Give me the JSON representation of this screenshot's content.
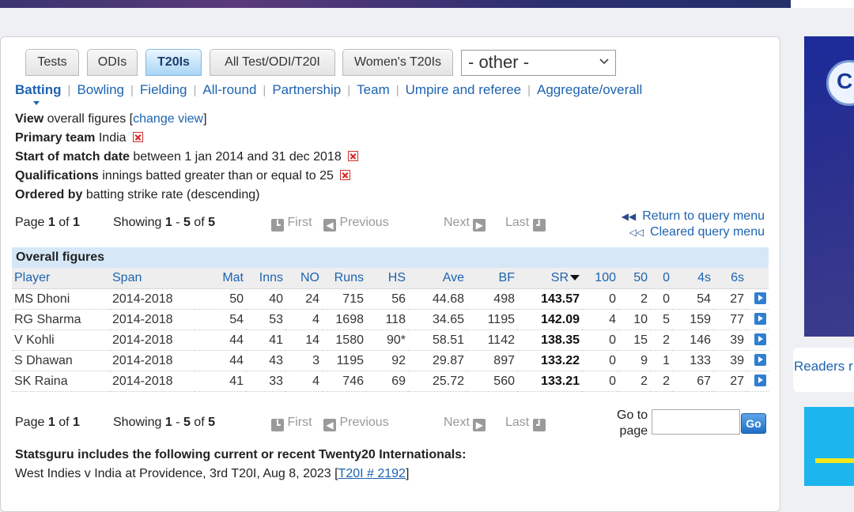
{
  "tabs": [
    {
      "label": "Tests",
      "active": false
    },
    {
      "label": "ODIs",
      "active": false
    },
    {
      "label": "T20Is",
      "active": true
    },
    {
      "label": "All Test/ODI/T20I",
      "active": false
    },
    {
      "label": "Women's T20Is",
      "active": false
    }
  ],
  "other_select": {
    "value": "- other -"
  },
  "subnav": [
    "Batting",
    "Bowling",
    "Fielding",
    "All-round",
    "Partnership",
    "Team",
    "Umpire and referee",
    "Aggregate/overall"
  ],
  "criteria": {
    "view": {
      "label": "View",
      "text": "overall figures [",
      "link": "change view",
      "close": "]"
    },
    "primary": {
      "label": "Primary team",
      "value": "India"
    },
    "date": {
      "label": "Start of match date",
      "value": "between 1 jan 2014 and 31 dec 2018"
    },
    "qual": {
      "label": "Qualifications",
      "value": "innings batted greater than or equal to 25"
    },
    "order": {
      "label": "Ordered by",
      "value": "batting strike rate (descending)"
    }
  },
  "pager": {
    "page_word": "Page",
    "page": "1",
    "of_word": "of",
    "pages": "1",
    "showing_word": "Showing",
    "from": "1",
    "to": "5",
    "total": "5",
    "first": "First",
    "previous": "Previous",
    "next": "Next",
    "last": "Last"
  },
  "query_links": {
    "return": "Return to query menu",
    "cleared": "Cleared query menu"
  },
  "table": {
    "caption": "Overall figures",
    "headers": [
      "Player",
      "Span",
      "Mat",
      "Inns",
      "NO",
      "Runs",
      "HS",
      "Ave",
      "BF",
      "SR",
      "100",
      "50",
      "0",
      "4s",
      "6s"
    ],
    "rows": [
      [
        "MS Dhoni",
        "2014-2018",
        "50",
        "40",
        "24",
        "715",
        "56",
        "44.68",
        "498",
        "143.57",
        "0",
        "2",
        "0",
        "54",
        "27"
      ],
      [
        "RG Sharma",
        "2014-2018",
        "54",
        "53",
        "4",
        "1698",
        "118",
        "34.65",
        "1195",
        "142.09",
        "4",
        "10",
        "5",
        "159",
        "77"
      ],
      [
        "V Kohli",
        "2014-2018",
        "44",
        "41",
        "14",
        "1580",
        "90*",
        "58.51",
        "1142",
        "138.35",
        "0",
        "15",
        "2",
        "146",
        "39"
      ],
      [
        "S Dhawan",
        "2014-2018",
        "44",
        "43",
        "3",
        "1195",
        "92",
        "29.87",
        "897",
        "133.22",
        "0",
        "9",
        "1",
        "133",
        "39"
      ],
      [
        "SK Raina",
        "2014-2018",
        "41",
        "33",
        "4",
        "746",
        "69",
        "25.72",
        "560",
        "133.21",
        "0",
        "2",
        "2",
        "67",
        "27"
      ]
    ]
  },
  "goto": {
    "line1": "Go to",
    "line2": "page",
    "button": "Go"
  },
  "footer": {
    "title": "Statsguru includes the following current or recent Twenty20 Internationals:",
    "line": "West Indies v India at Providence, 3rd T20I, Aug 8, 2023 [",
    "link": "T20I # 2192",
    "close": "]"
  },
  "sidebar": {
    "readers": "Readers r"
  }
}
